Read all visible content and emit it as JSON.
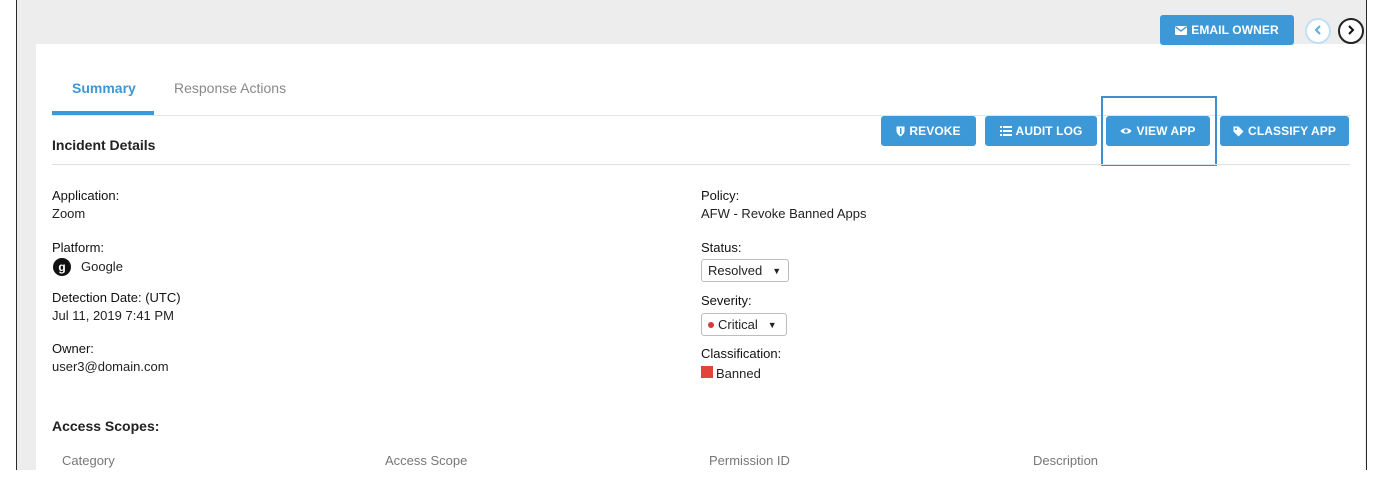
{
  "toolbar": {
    "email_owner": "EMAIL OWNER"
  },
  "tabs": {
    "summary": "Summary",
    "response_actions": "Response Actions"
  },
  "section": {
    "incident_details": "Incident Details",
    "access_scopes": "Access Scopes:"
  },
  "actions": {
    "revoke": "REVOKE",
    "audit_log": "AUDIT LOG",
    "view_app": "VIEW APP",
    "classify_app": "CLASSIFY APP"
  },
  "details": {
    "application_label": "Application:",
    "application_value": "Zoom",
    "platform_label": "Platform:",
    "platform_value": "Google",
    "platform_icon_letter": "g",
    "detection_label": "Detection Date: (UTC)",
    "detection_value": "Jul 11, 2019 7:41 PM",
    "owner_label": "Owner:",
    "owner_value": "user3@domain.com",
    "policy_label": "Policy:",
    "policy_value": "AFW - Revoke Banned Apps",
    "status_label": "Status:",
    "status_value": "Resolved",
    "severity_label": "Severity:",
    "severity_value": "Critical",
    "classification_label": "Classification:",
    "classification_value": "Banned"
  },
  "table": {
    "columns": [
      "Category",
      "Access Scope",
      "Permission ID",
      "Description"
    ]
  },
  "colors": {
    "primary": "#3c98d6",
    "critical": "#d9363e",
    "banned": "#e0443a",
    "highlight_border": "#3c8fd0"
  }
}
